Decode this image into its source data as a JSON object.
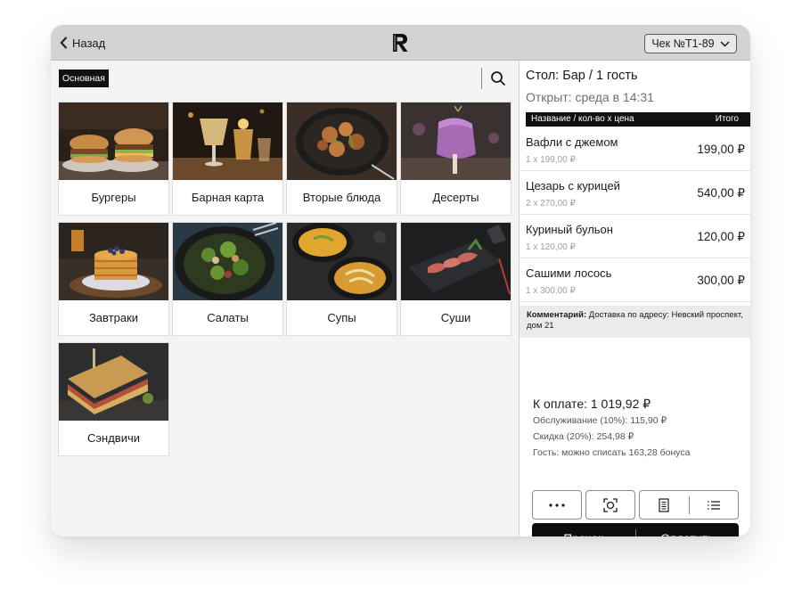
{
  "header": {
    "back_label": "Назад",
    "check_label": "Чек №Т1-89"
  },
  "catalog": {
    "category_tag": "Основная",
    "tiles": [
      {
        "label": "Бургеры",
        "icon": "burger-photo"
      },
      {
        "label": "Барная карта",
        "icon": "cocktail-photo"
      },
      {
        "label": "Вторые блюда",
        "icon": "main-dish-photo"
      },
      {
        "label": "Десерты",
        "icon": "dessert-photo"
      },
      {
        "label": "Завтраки",
        "icon": "pancakes-photo"
      },
      {
        "label": "Салаты",
        "icon": "salad-photo"
      },
      {
        "label": "Супы",
        "icon": "soup-photo"
      },
      {
        "label": "Суши",
        "icon": "sashimi-photo"
      },
      {
        "label": "Сэндвичи",
        "icon": "sandwich-photo"
      }
    ]
  },
  "receipt": {
    "table": "Стол: Бар / 1 гость",
    "opened": "Открыт: среда в 14:31",
    "col_name": "Название / кол-во х цена",
    "col_total": "Итого",
    "items": [
      {
        "name": "Вафли с джемом",
        "qty": "1 x 199,00 ₽",
        "sum": "199,00 ₽"
      },
      {
        "name": "Цезарь с курицей",
        "qty": "2 x 270,00 ₽",
        "sum": "540,00 ₽"
      },
      {
        "name": "Куриный бульон",
        "qty": "1 x 120,00 ₽",
        "sum": "120,00 ₽"
      },
      {
        "name": "Сашими лосось",
        "qty": "1 x 300,00 ₽",
        "sum": "300,00 ₽"
      }
    ],
    "comment_label": "Комментарий:",
    "comment_text": " Доставка по адресу: Невский проспект, дом 21",
    "total": "К оплате: 1 019,92 ₽",
    "service": "Обслуживание (10%): 115,90 ₽",
    "discount": "Скидка (20%): 254,98 ₽",
    "bonus": "Гость: можно списать 163,28 бонуса",
    "precheck_label": "Пречек",
    "pay_label": "Оплатить"
  },
  "colors": {
    "accent": "#0d0d0d",
    "topbar": "#d3d3d3",
    "background": "#f4f4f4"
  }
}
